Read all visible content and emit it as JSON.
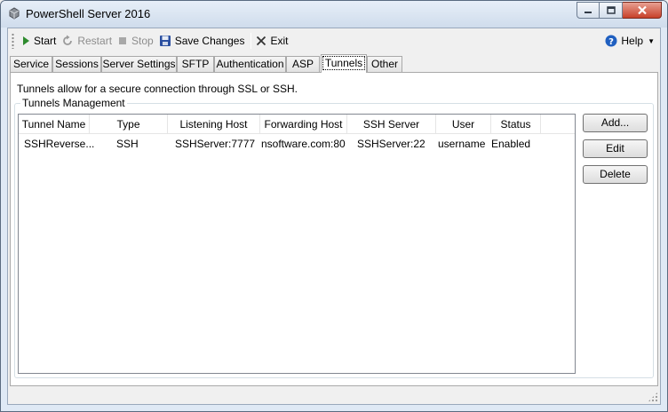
{
  "window": {
    "title": "PowerShell Server 2016"
  },
  "toolbar": {
    "start": "Start",
    "restart": "Restart",
    "stop": "Stop",
    "save": "Save Changes",
    "exit": "Exit",
    "help": "Help"
  },
  "tabs": [
    "Service",
    "Sessions",
    "Server Settings",
    "SFTP",
    "Authentication",
    "ASP",
    "Tunnels",
    "Other"
  ],
  "active_tab": "Tunnels",
  "panel": {
    "description": "Tunnels allow for a secure connection through SSL or SSH.",
    "group_title": "Tunnels Management"
  },
  "table": {
    "columns": [
      "Tunnel Name",
      "Type",
      "Listening Host",
      "Forwarding Host",
      "SSH Server",
      "User",
      "Status"
    ],
    "rows": [
      [
        "SSHReverse...",
        "SSH",
        "SSHServer:7777",
        "nsoftware.com:80",
        "SSHServer:22",
        "username",
        "Enabled"
      ]
    ]
  },
  "buttons": {
    "add": "Add...",
    "edit": "Edit",
    "delete": "Delete"
  },
  "colors": {
    "start_icon": "#2e8b2e",
    "save_icon": "#2a4fa0",
    "help_icon": "#1f5fc0",
    "close_button": "#c7412a"
  }
}
